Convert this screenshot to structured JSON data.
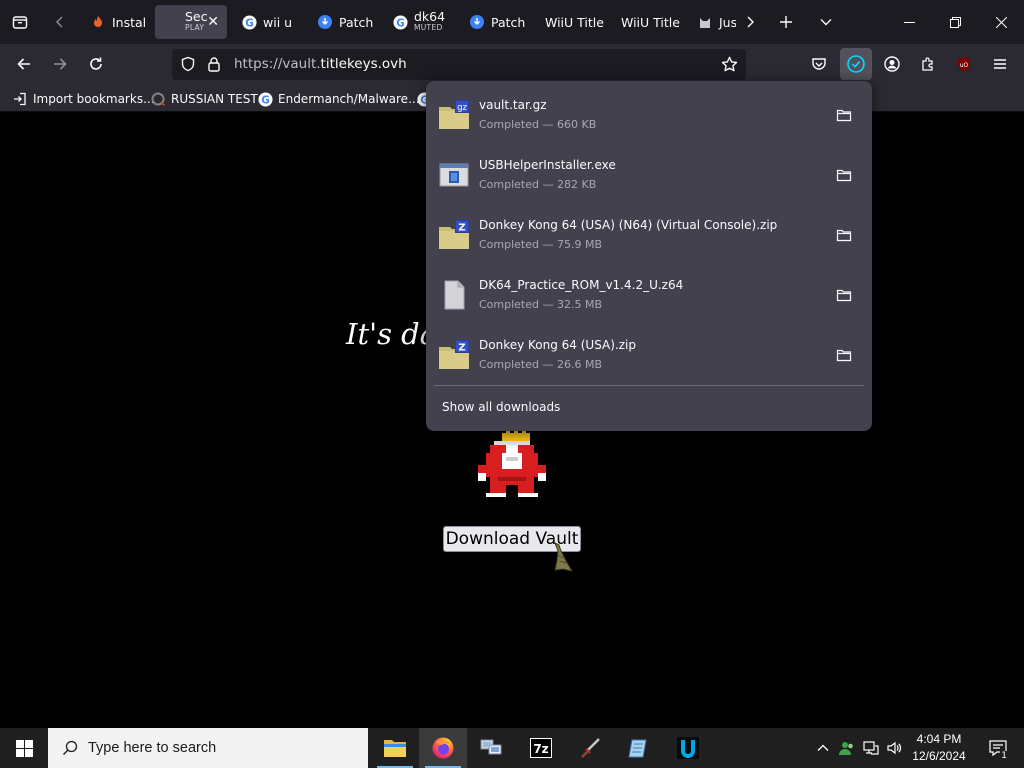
{
  "tabs": [
    {
      "label": "Instal",
      "sub": ""
    },
    {
      "label": "Sec",
      "sub": "PLAY"
    },
    {
      "label": "wii u",
      "sub": ""
    },
    {
      "label": "Patch",
      "sub": ""
    },
    {
      "label": "dk64",
      "sub": "MUTED"
    },
    {
      "label": "Patch",
      "sub": ""
    },
    {
      "label": "WiiU Title",
      "sub": ""
    },
    {
      "label": "WiiU Title",
      "sub": ""
    },
    {
      "label": "Jus",
      "sub": ""
    }
  ],
  "address_bar": {
    "url_dim": "https://vault.",
    "url_main": "titlekeys.ovh"
  },
  "bookmarks": [
    {
      "label": "Import bookmarks...",
      "icon": "import-icon"
    },
    {
      "label": "RUSSIAN TEST",
      "icon": "site-icon"
    },
    {
      "label": "Endermanch/Malware...",
      "icon": "google-icon"
    }
  ],
  "page": {
    "heading": "It's dan",
    "download_button": "Download Vault"
  },
  "downloads": {
    "items": [
      {
        "name": "vault.tar.gz",
        "status": "Completed — 660 KB",
        "icon": "gz-archive-icon"
      },
      {
        "name": "USBHelperInstaller.exe",
        "status": "Completed — 282 KB",
        "icon": "exe-icon"
      },
      {
        "name": "Donkey Kong 64 (USA) (N64) (Virtual Console).zip",
        "status": "Completed — 75.9 MB",
        "icon": "zip-archive-icon"
      },
      {
        "name": "DK64_Practice_ROM_v1.4.2_U.z64",
        "status": "Completed — 32.5 MB",
        "icon": "file-icon"
      },
      {
        "name": "Donkey Kong 64 (USA).zip",
        "status": "Completed — 26.6 MB",
        "icon": "zip-archive-icon"
      }
    ],
    "show_all": "Show all downloads"
  },
  "taskbar": {
    "search_placeholder": "Type here to search",
    "time": "4:04 PM",
    "date": "12/6/2024",
    "notification_count": "1"
  },
  "colors": {
    "tab_strip": "#1c1b22",
    "toolbar": "#2b2a33",
    "panel": "#42414d",
    "accent": "#00ddff"
  }
}
